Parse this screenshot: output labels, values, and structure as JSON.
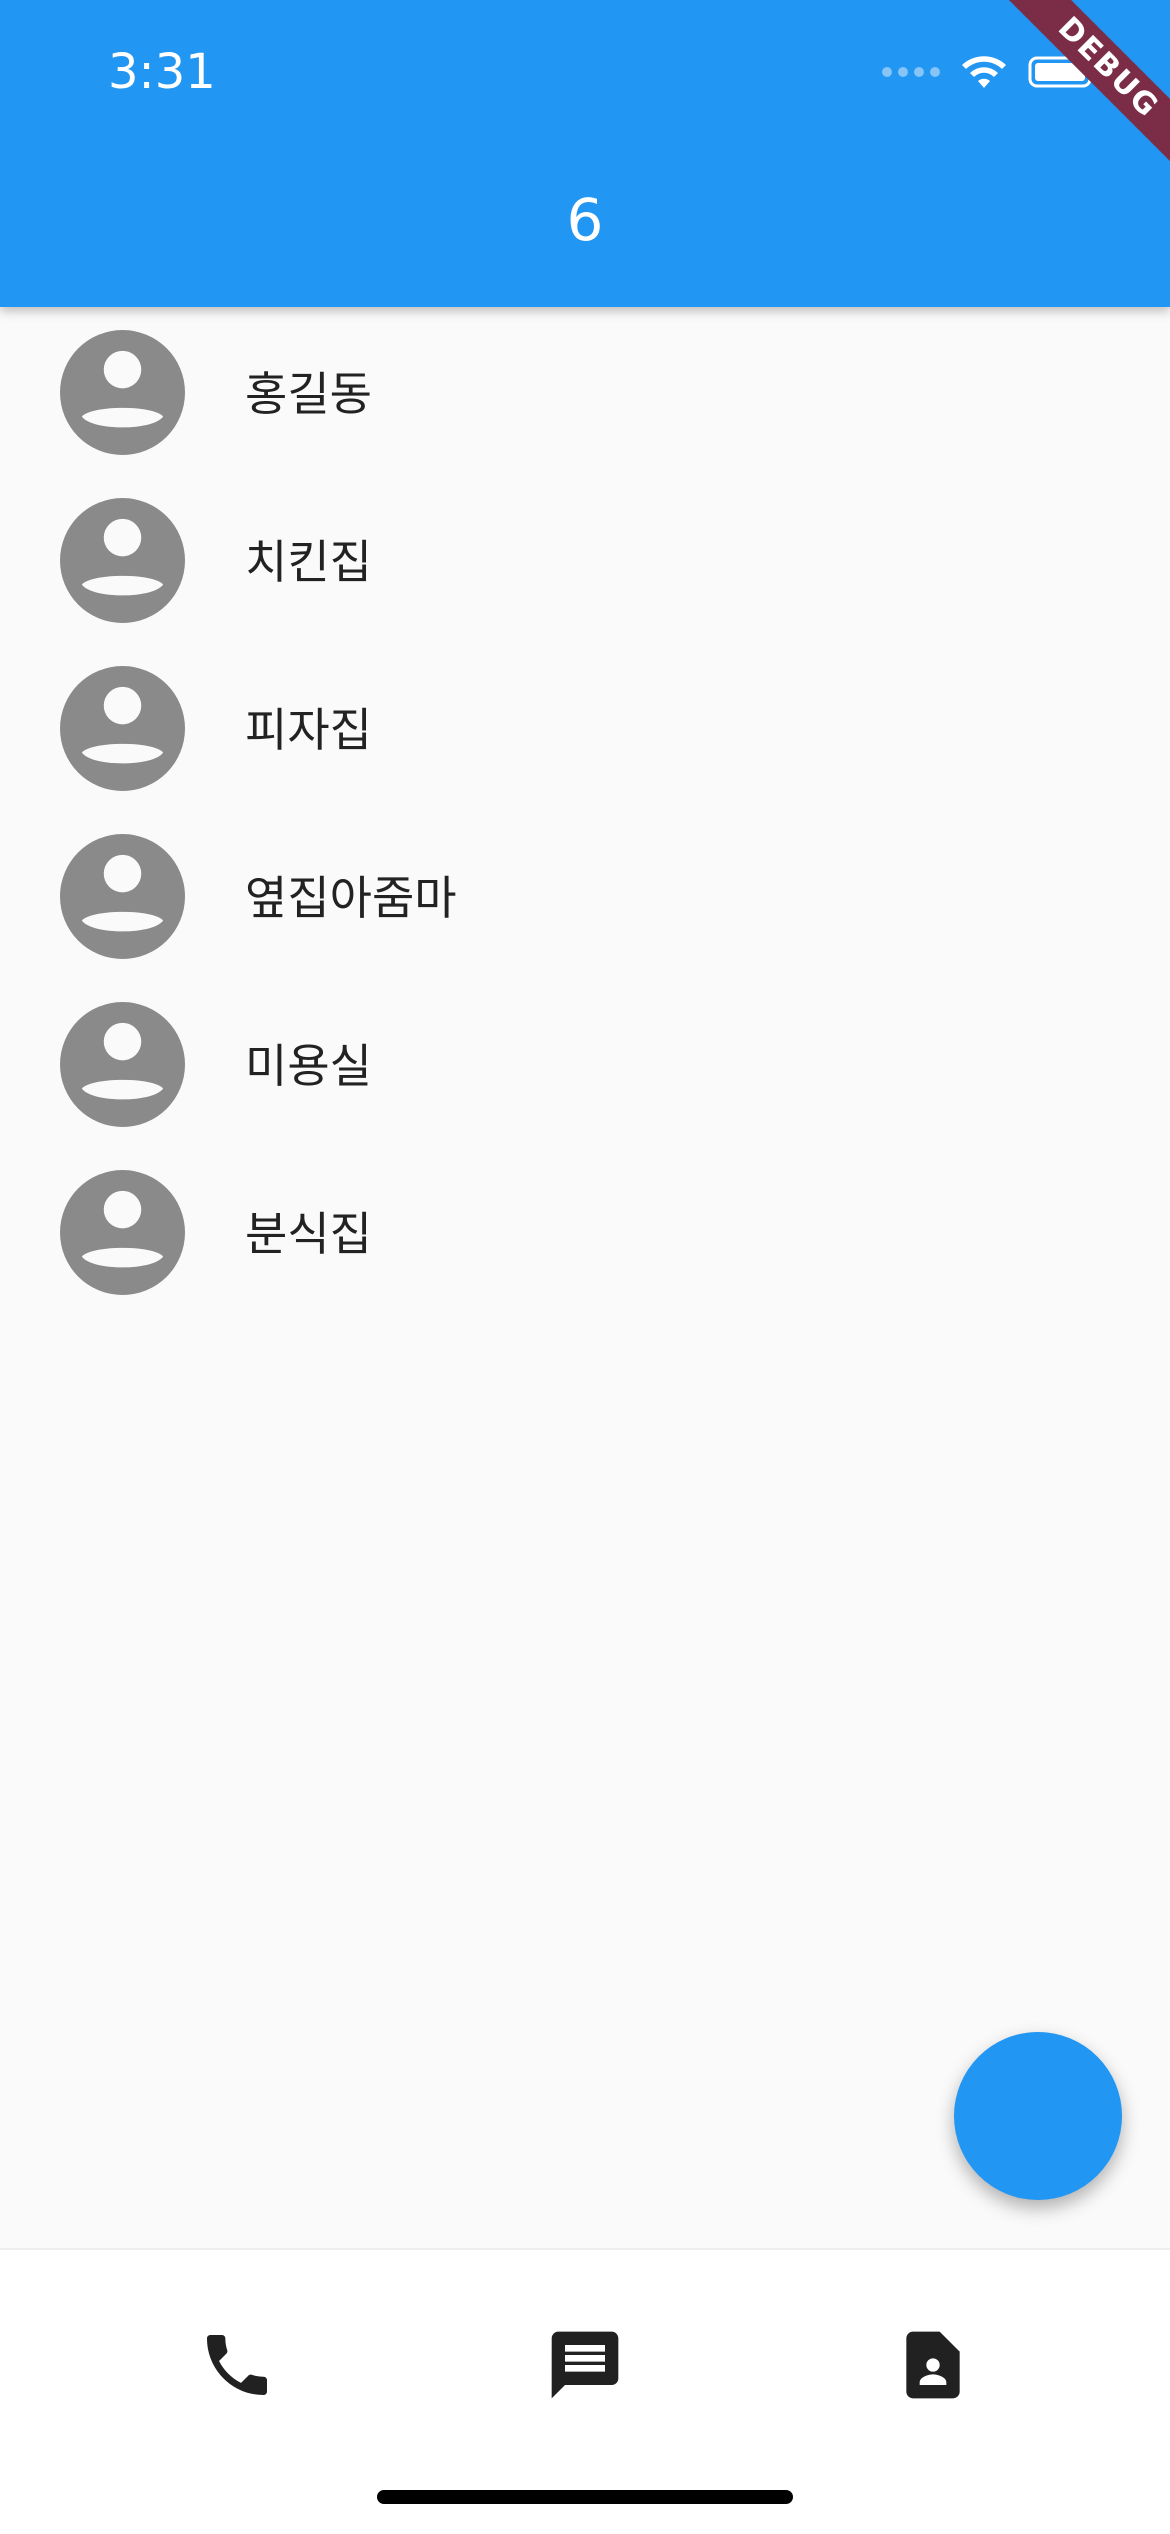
{
  "status_bar": {
    "time": "3:31"
  },
  "debug_banner": "DEBUG",
  "app_bar": {
    "title": "6"
  },
  "contacts": [
    {
      "name": "홍길동"
    },
    {
      "name": "치킨집"
    },
    {
      "name": "피자집"
    },
    {
      "name": "옆집아줌마"
    },
    {
      "name": "미용실"
    },
    {
      "name": "분식집"
    }
  ],
  "bottom_nav": {
    "items": [
      {
        "icon": "phone-icon"
      },
      {
        "icon": "message-icon"
      },
      {
        "icon": "contact-card-icon"
      }
    ]
  },
  "colors": {
    "primary": "#2196f3",
    "avatar": "#8a8a8a",
    "background": "#fafafa",
    "debug_ribbon": "#7b2d47"
  }
}
